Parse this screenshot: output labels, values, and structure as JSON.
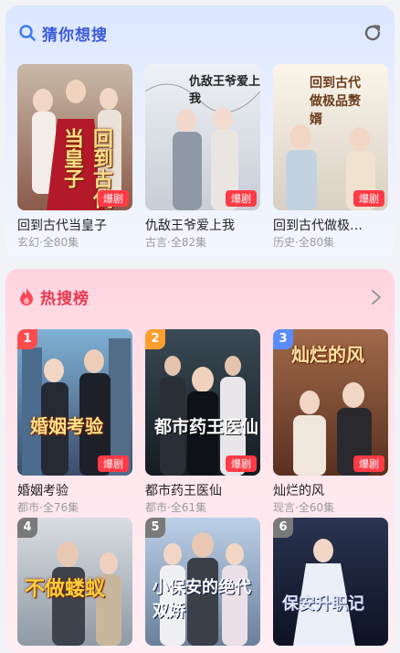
{
  "guess": {
    "title": "猜你想搜",
    "items": [
      {
        "title": "回到古代当皇子",
        "meta": "玄幻·全80集",
        "badge": "爆剧",
        "poster_text": "回到古代当皇子"
      },
      {
        "title": "仇敌王爷爱上我",
        "meta": "古言·全82集",
        "badge": "爆剧",
        "poster_text": "仇敌王爷爱上我"
      },
      {
        "title": "回到古代做极…",
        "meta": "历史·全80集",
        "badge": "爆剧",
        "poster_text": "回到古代做极品赘婿"
      }
    ]
  },
  "hot": {
    "title": "热搜榜",
    "items": [
      {
        "rank": "1",
        "title": "婚姻考验",
        "meta": "都市·全76集",
        "badge": "爆剧",
        "poster_text": "婚姻考验"
      },
      {
        "rank": "2",
        "title": "都市药王医仙",
        "meta": "都市·全61集",
        "badge": "爆剧",
        "poster_text": "都市药王医仙"
      },
      {
        "rank": "3",
        "title": "灿烂的风",
        "meta": "现言·全60集",
        "badge": "爆剧",
        "poster_text": "灿烂的风"
      },
      {
        "rank": "4",
        "poster_text": "不做蝼蚁"
      },
      {
        "rank": "5",
        "poster_text": "小保安的绝代双娇"
      },
      {
        "rank": "6",
        "poster_text": "保安升职记"
      }
    ]
  },
  "colors": {
    "rank1": "#ff4d4f",
    "rank2": "#ff9d2e",
    "rank3": "#5b8cff",
    "rank_other": "#7a7a7a",
    "badge": "#ff3b46"
  }
}
